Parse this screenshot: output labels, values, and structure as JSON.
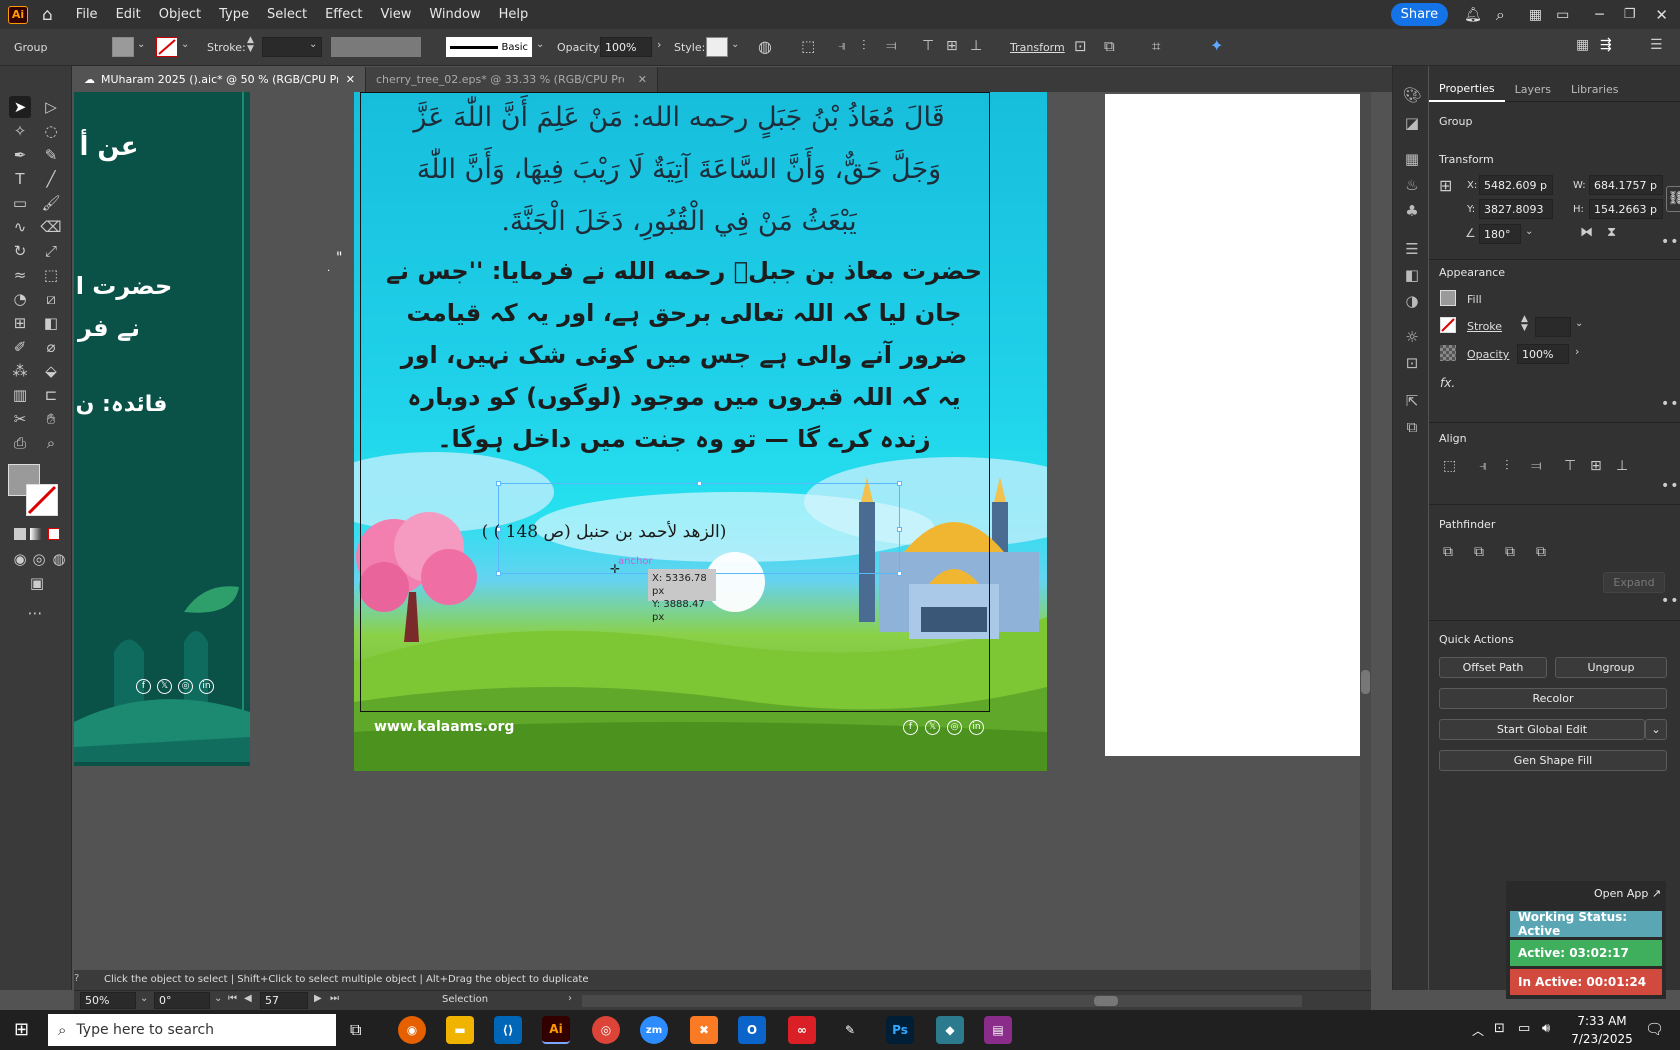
{
  "menubar": {
    "logo": "Ai",
    "items": [
      "File",
      "Edit",
      "Object",
      "Type",
      "Select",
      "Effect",
      "View",
      "Window",
      "Help"
    ],
    "share": "Share"
  },
  "control": {
    "selection": "Group",
    "stroke_label": "Stroke:",
    "brush": "Basic",
    "opacity_label": "Opacity:",
    "opacity_value": "100%",
    "style_label": "Style:",
    "transform": "Transform"
  },
  "tabs": [
    {
      "label": "MUharam 2025 ().aic* @ 50 % (RGB/CPU Preview)",
      "close": "✕"
    },
    {
      "label": "cherry_tree_02.eps* @ 33.33 % (RGB/CPU Preview)",
      "close": "✕"
    }
  ],
  "artboard": {
    "arabic_lines": [
      "قَالَ مُعَاذُ بْنُ جَبَلٍ رحمه الله: مَنْ عَلِمَ أَنَّ اللّٰهَ عَزَّ",
      "وَجَلَّ حَقٌّ، وَأَنَّ السَّاعَةَ آتِيَةٌ لَا رَيْبَ فِيهَا، وَأَنَّ اللّٰهَ",
      "يَبْعَثُ مَنْ فِي الْقُبُورِ، دَخَلَ الْجَنَّةَ."
    ],
    "urdu_lines": [
      "حضرت معاذ بن جبلؒ رحمه الله نے فرمایا: ''جس نے",
      "جان لیا کہ اللہ تعالی برحق ہے، اور یہ کہ قیامت",
      "ضرور آنے والی ہے جس میں کوئی شک نہیں، اور",
      "یہ کہ اللہ قبروں میں موجود (لوگوں) کو دوبارہ",
      "زندہ کرے گا — تو وہ جنت میں داخل ہوگا۔"
    ],
    "reference": "(الزهد لأحمد بن حنبل (ص 148 ) )",
    "anchor": "anchor",
    "coord_x": "X: 5336.78 px",
    "coord_y": "Y: 3888.47 px",
    "website": "www.kalaams.org",
    "social": [
      "f",
      "𝕏",
      "◎",
      "in"
    ],
    "quote_mark": "\""
  },
  "left_board": {
    "lines": [
      "عن أ",
      "حضرت ا",
      "نے فر",
      "فائدہ: ن"
    ]
  },
  "properties": {
    "tabs": [
      "Properties",
      "Layers",
      "Libraries"
    ],
    "group": "Group",
    "transform": {
      "title": "Transform",
      "x_label": "X:",
      "x": "5482.609 p",
      "y_label": "Y:",
      "y": "3827.8093",
      "w_label": "W:",
      "w": "684.1757 p",
      "h_label": "H:",
      "h": "154.2663 p",
      "angle": "180°"
    },
    "appearance": {
      "title": "Appearance",
      "fill": "Fill",
      "stroke": "Stroke",
      "opacity": "Opacity",
      "opacity_value": "100%",
      "fx": "fx."
    },
    "align_title": "Align",
    "pathfinder_title": "Pathfinder",
    "expand": "Expand",
    "quick_actions": {
      "title": "Quick Actions",
      "offset_path": "Offset Path",
      "ungroup": "Ungroup",
      "recolor": "Recolor",
      "global_edit": "Start Global Edit",
      "gen_shape": "Gen Shape Fill"
    }
  },
  "status": {
    "hint": "Click the object to select  |  Shift+Click to select multiple object  |  Alt+Drag the object to duplicate",
    "zoom": "50%",
    "rotation": "0°",
    "artboard": "57",
    "mode": "Selection"
  },
  "tracker": {
    "open_app": "Open App ↗",
    "working": "Working Status: Active",
    "active": "Active: 03:02:17",
    "inactive": "In Active: 00:01:24"
  },
  "taskbar": {
    "search": "Type here to search",
    "time": "7:33 AM",
    "date": "7/23/2025"
  },
  "colors": {
    "accent": "#1473e6",
    "sky_top": "#1cc0de",
    "grass": "#7cc62e",
    "working": "#5aa6b5",
    "active": "#3fae5d",
    "inactive": "#d24a3e"
  }
}
